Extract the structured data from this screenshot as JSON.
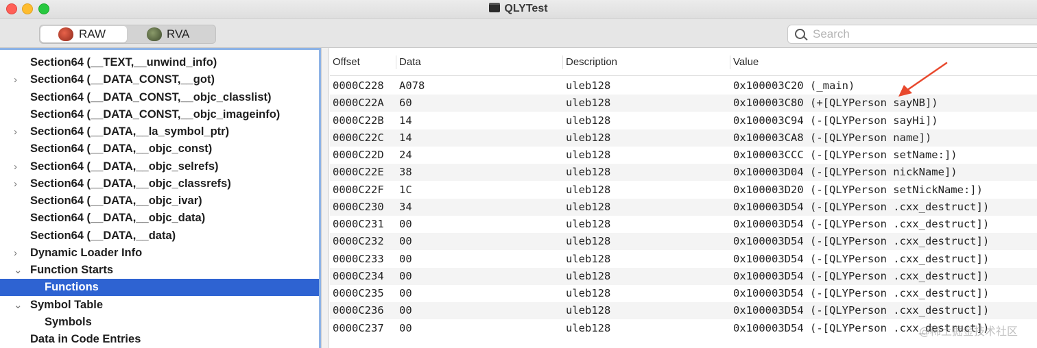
{
  "window": {
    "title": "QLYTest"
  },
  "toolbar": {
    "raw_label": "RAW",
    "rva_label": "RVA",
    "search_placeholder": "Search"
  },
  "sidebar": {
    "items": [
      {
        "label": "Section64 (__TEXT,__unwind_info)",
        "indent": 0,
        "disclosure": ""
      },
      {
        "label": "Section64 (__DATA_CONST,__got)",
        "indent": 0,
        "disclosure": "›"
      },
      {
        "label": "Section64 (__DATA_CONST,__objc_classlist)",
        "indent": 0,
        "disclosure": ""
      },
      {
        "label": "Section64 (__DATA_CONST,__objc_imageinfo)",
        "indent": 0,
        "disclosure": ""
      },
      {
        "label": "Section64 (__DATA,__la_symbol_ptr)",
        "indent": 0,
        "disclosure": "›"
      },
      {
        "label": "Section64 (__DATA,__objc_const)",
        "indent": 0,
        "disclosure": ""
      },
      {
        "label": "Section64 (__DATA,__objc_selrefs)",
        "indent": 0,
        "disclosure": "›"
      },
      {
        "label": "Section64 (__DATA,__objc_classrefs)",
        "indent": 0,
        "disclosure": "›"
      },
      {
        "label": "Section64 (__DATA,__objc_ivar)",
        "indent": 0,
        "disclosure": ""
      },
      {
        "label": "Section64 (__DATA,__objc_data)",
        "indent": 0,
        "disclosure": ""
      },
      {
        "label": "Section64 (__DATA,__data)",
        "indent": 0,
        "disclosure": ""
      },
      {
        "label": "Dynamic Loader Info",
        "indent": 0,
        "disclosure": "›"
      },
      {
        "label": "Function Starts",
        "indent": 0,
        "disclosure": "⌄"
      },
      {
        "label": "Functions",
        "indent": 1,
        "disclosure": "",
        "selected": true
      },
      {
        "label": "Symbol Table",
        "indent": 0,
        "disclosure": "⌄"
      },
      {
        "label": "Symbols",
        "indent": 1,
        "disclosure": ""
      },
      {
        "label": "Data in Code Entries",
        "indent": 0,
        "disclosure": ""
      }
    ]
  },
  "table": {
    "columns": [
      "Offset",
      "Data",
      "Description",
      "Value"
    ],
    "rows": [
      [
        "0000C228",
        "A078",
        "uleb128",
        "0x100003C20 (_main)"
      ],
      [
        "0000C22A",
        "60",
        "uleb128",
        "0x100003C80 (+[QLYPerson sayNB])"
      ],
      [
        "0000C22B",
        "14",
        "uleb128",
        "0x100003C94 (-[QLYPerson sayHi])"
      ],
      [
        "0000C22C",
        "14",
        "uleb128",
        "0x100003CA8 (-[QLYPerson name])"
      ],
      [
        "0000C22D",
        "24",
        "uleb128",
        "0x100003CCC (-[QLYPerson setName:])"
      ],
      [
        "0000C22E",
        "38",
        "uleb128",
        "0x100003D04 (-[QLYPerson nickName])"
      ],
      [
        "0000C22F",
        "1C",
        "uleb128",
        "0x100003D20 (-[QLYPerson setNickName:])"
      ],
      [
        "0000C230",
        "34",
        "uleb128",
        "0x100003D54 (-[QLYPerson .cxx_destruct])"
      ],
      [
        "0000C231",
        "00",
        "uleb128",
        "0x100003D54 (-[QLYPerson .cxx_destruct])"
      ],
      [
        "0000C232",
        "00",
        "uleb128",
        "0x100003D54 (-[QLYPerson .cxx_destruct])"
      ],
      [
        "0000C233",
        "00",
        "uleb128",
        "0x100003D54 (-[QLYPerson .cxx_destruct])"
      ],
      [
        "0000C234",
        "00",
        "uleb128",
        "0x100003D54 (-[QLYPerson .cxx_destruct])"
      ],
      [
        "0000C235",
        "00",
        "uleb128",
        "0x100003D54 (-[QLYPerson .cxx_destruct])"
      ],
      [
        "0000C236",
        "00",
        "uleb128",
        "0x100003D54 (-[QLYPerson .cxx_destruct])"
      ],
      [
        "0000C237",
        "00",
        "uleb128",
        "0x100003D54 (-[QLYPerson .cxx_destruct])"
      ]
    ]
  },
  "annotation": {
    "arrow_color": "#e8482d",
    "icon": "arrow-icon"
  },
  "watermark": {
    "text": "@稀土掘金技术社区"
  },
  "colors": {
    "selection": "#2e63d2",
    "sidebar_focus_ring": "#8db3e6"
  }
}
